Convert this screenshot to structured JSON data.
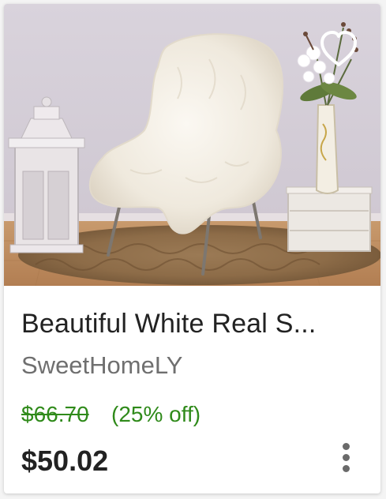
{
  "listing": {
    "title": "Beautiful White Real S...",
    "shop_name": "SweetHomeLY",
    "original_price": "$66.70",
    "discount": "(25% off)",
    "price": "$50.02",
    "favorite_icon": "heart-outline-icon",
    "more_icon": "more-vertical-icon"
  },
  "colors": {
    "sale_green": "#2f8a1a",
    "text_dark": "#222222",
    "text_muted": "#6f6f6f"
  }
}
